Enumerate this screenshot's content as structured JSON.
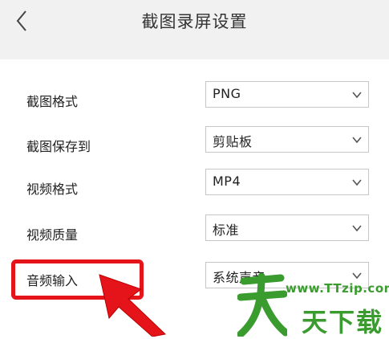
{
  "header": {
    "title": "截图录屏设置",
    "back_icon": "chevron-left-icon"
  },
  "settings": {
    "screenshot_format": {
      "label": "截图格式",
      "value": "PNG"
    },
    "screenshot_save_to": {
      "label": "截图保存到",
      "value": "剪贴板"
    },
    "video_format": {
      "label": "视频格式",
      "value": "MP4"
    },
    "video_quality": {
      "label": "视频质量",
      "value": "标准"
    },
    "audio_input": {
      "label": "音频输入",
      "value": "系统声音"
    }
  },
  "annotation": {
    "highlight_color": "#e5141b"
  },
  "watermark": {
    "site": "www.TTzip.com",
    "brand": "天下载",
    "color": "#3a9b2f"
  }
}
